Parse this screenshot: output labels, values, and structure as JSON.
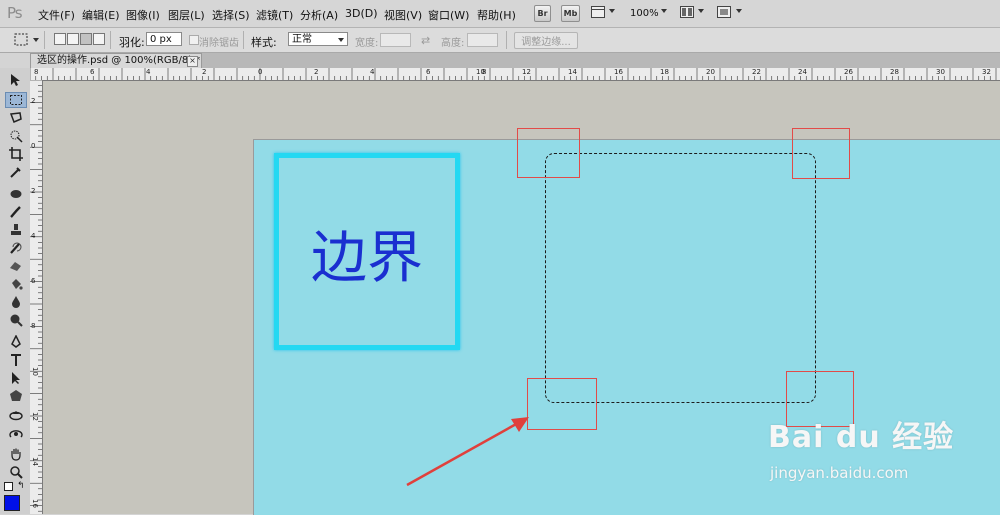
{
  "app": {
    "logo": "Ps"
  },
  "menu": {
    "items": [
      "文件(F)",
      "编辑(E)",
      "图像(I)",
      "图层(L)",
      "选择(S)",
      "滤镜(T)",
      "分析(A)",
      "3D(D)",
      "视图(V)",
      "窗口(W)",
      "帮助(H)"
    ],
    "br_label": "Br",
    "mb_label": "Mb",
    "zoom": "100%"
  },
  "options": {
    "feather_label": "羽化:",
    "feather_value": "0 px",
    "antialias_label": "消除锯齿",
    "style_label": "样式:",
    "style_value": "正常",
    "width_label": "宽度:",
    "height_label": "高度:",
    "refine_label": "调整边缘..."
  },
  "document": {
    "tab_title": "选区的操作.psd @ 100%(RGB/8) *",
    "close_glyph": "×"
  },
  "rulers": {
    "top_labels": [
      "8",
      "6",
      "4",
      "2",
      "0",
      "2",
      "4",
      "6",
      "8",
      "10",
      "12",
      "14",
      "16",
      "18",
      "20",
      "22",
      "24",
      "26",
      "28",
      "30",
      "32"
    ],
    "left_labels": [
      "2",
      "0",
      "2",
      "4",
      "6",
      "8",
      "10",
      "12",
      "14",
      "16"
    ]
  },
  "canvas": {
    "content_text": "边界",
    "colors": {
      "canvas_bg": "#92dbe7",
      "border_stroke": "#24d8f2",
      "text": "#1a2fd0",
      "highlight_box": "#e24b48",
      "arrow": "#e0403c"
    }
  },
  "watermark": {
    "logo": "Bai du 经验",
    "url": "jingyan.baidu.com"
  },
  "icons": [
    "move-icon",
    "rect-marquee-icon",
    "lasso-icon",
    "quick-select-icon",
    "crop-icon",
    "eyedropper-icon",
    "healing-icon",
    "brush-icon",
    "stamp-icon",
    "history-brush-icon",
    "eraser-icon",
    "paint-bucket-icon",
    "blur-icon",
    "dodge-icon",
    "pen-icon",
    "type-icon",
    "path-select-icon",
    "shape-icon",
    "3d-rotate-icon",
    "3d-orbit-icon",
    "hand-icon",
    "zoom-icon"
  ]
}
